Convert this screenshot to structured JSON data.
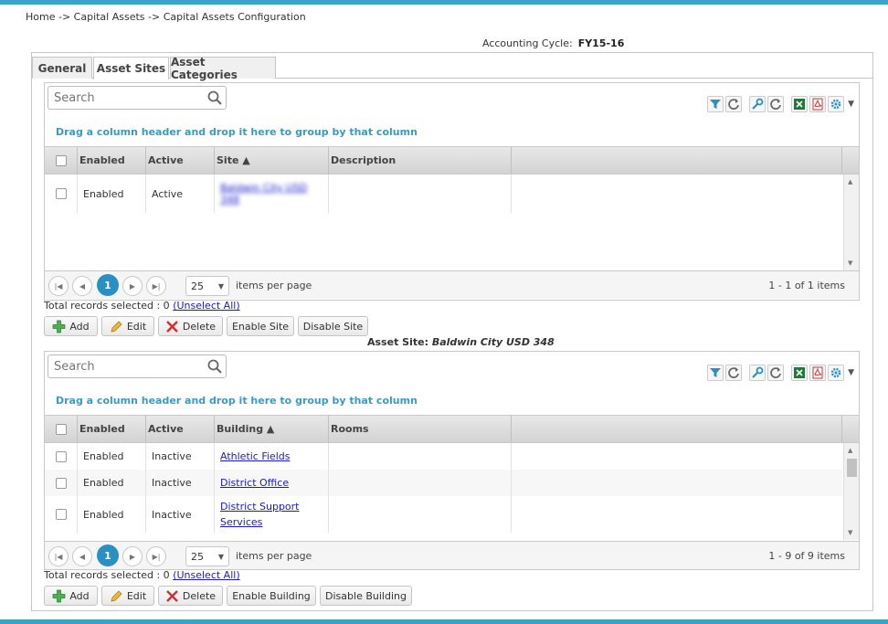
{
  "breadcrumb": "Home -> Capital Assets -> Capital Assets Configuration",
  "cycle": {
    "label": "Accounting Cycle:",
    "value": "FY15-16"
  },
  "tabs": [
    {
      "label": "General"
    },
    {
      "label": "Asset Sites"
    },
    {
      "label": "Asset Categories"
    }
  ],
  "colors": {
    "accent": "#3aa4c8",
    "link": "#1a1acb",
    "page_active": "#2a8fc5",
    "hint": "#3a9bc2"
  },
  "sites_grid": {
    "search_placeholder": "Search",
    "group_hint": "Drag a column header and drop it here to group by that column",
    "columns": {
      "enabled": "Enabled",
      "active": "Active",
      "site": "Site ▲",
      "description": "Description"
    },
    "rows": [
      {
        "enabled": "Enabled",
        "active": "Active",
        "site": "Baldwin City USD 348",
        "description": ""
      }
    ],
    "pager": {
      "page": "1",
      "page_size": "25",
      "per_page_text": "items per page",
      "info": "1 - 1 of 1 items"
    },
    "selected_prefix": "Total records selected : 0",
    "unselect": "(Unselect All)",
    "buttons": {
      "add": "Add",
      "edit": "Edit",
      "delete": "Delete",
      "enable": "Enable Site",
      "disable": "Disable Site"
    }
  },
  "asset_site": {
    "label": "Asset Site:",
    "value": "Baldwin City USD 348"
  },
  "buildings_grid": {
    "search_placeholder": "Search",
    "group_hint": "Drag a column header and drop it here to group by that column",
    "columns": {
      "enabled": "Enabled",
      "active": "Active",
      "building": "Building ▲",
      "rooms": "Rooms"
    },
    "rows": [
      {
        "enabled": "Enabled",
        "active": "Inactive",
        "building": "Athletic Fields",
        "rooms": ""
      },
      {
        "enabled": "Enabled",
        "active": "Inactive",
        "building": "District Office",
        "rooms": ""
      },
      {
        "enabled": "Enabled",
        "active": "Inactive",
        "building_line1": "District Support",
        "building_line2": "Services",
        "rooms": ""
      }
    ],
    "pager": {
      "page": "1",
      "page_size": "25",
      "per_page_text": "items per page",
      "info": "1 - 9 of 9 items"
    },
    "selected_prefix": "Total records selected : 0",
    "unselect": "(Unselect All)",
    "buttons": {
      "add": "Add",
      "edit": "Edit",
      "delete": "Delete",
      "enable": "Enable Building",
      "disable": "Disable Building"
    }
  }
}
